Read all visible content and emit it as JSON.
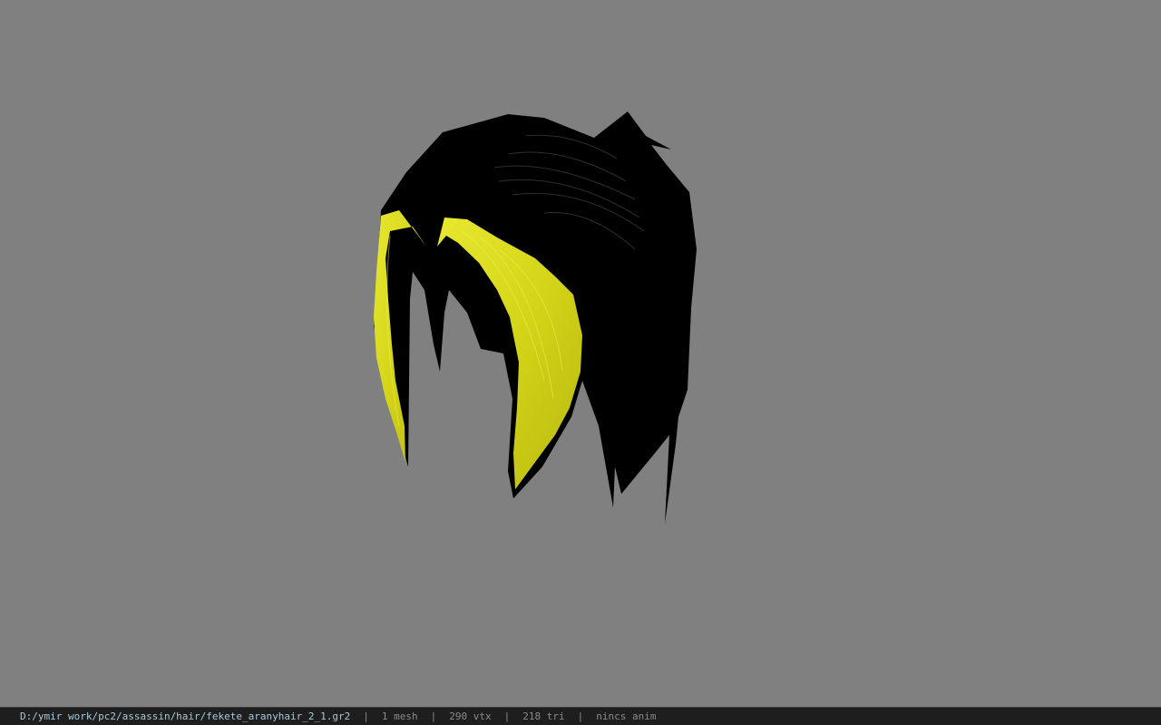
{
  "viewer": {
    "background_color": "#808080",
    "model_colors": {
      "hair_base": "#000000",
      "hair_highlight": "#d8d81a",
      "hair_highlight_dark": "#a8a808",
      "strand_shine": "#3a3a3a"
    }
  },
  "status": {
    "file_path": "D:/ymir work/pc2/assassin/hair/fekete_aranyhair_2_1.gr2",
    "sep": "|",
    "mesh_count": "1 mesh",
    "vertex_count": "290 vtx",
    "triangle_count": "218 tri",
    "animation": "nincs anim"
  }
}
